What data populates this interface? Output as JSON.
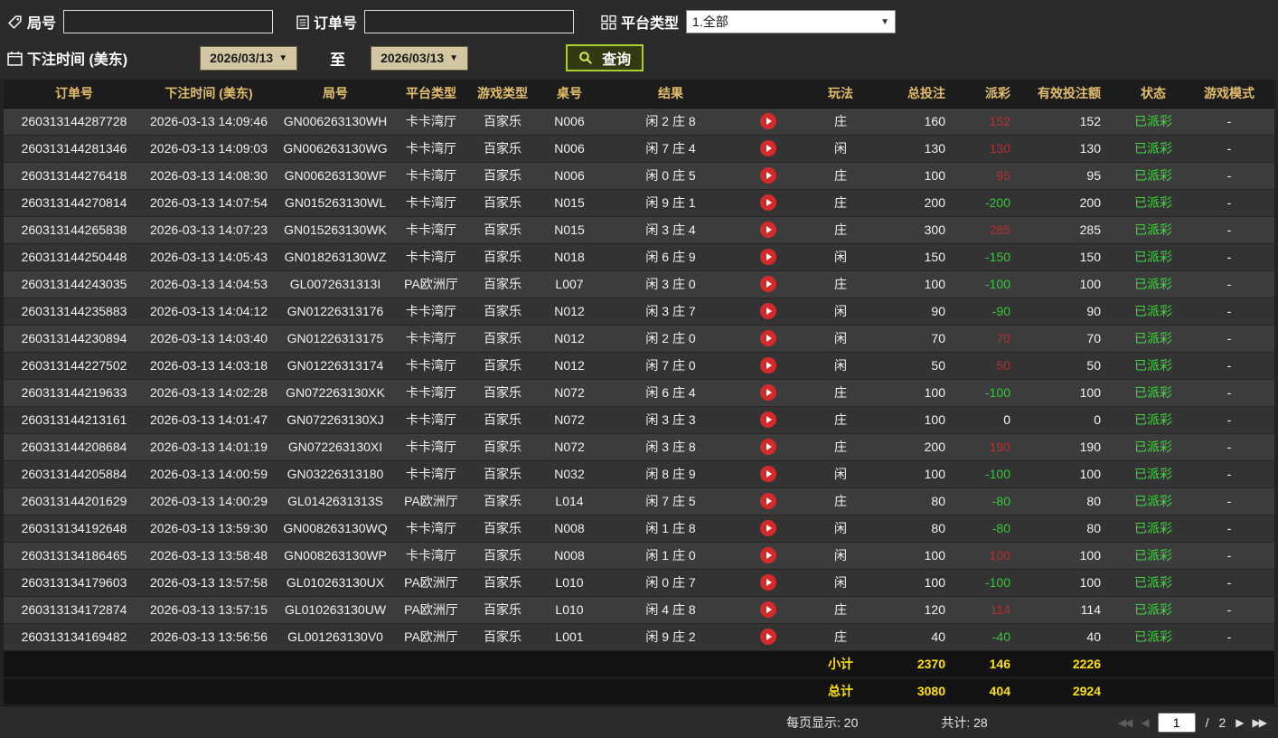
{
  "filters": {
    "round_label": "局号",
    "round_value": "",
    "order_label": "订单号",
    "order_value": "",
    "platform_label": "平台类型",
    "platform_value": "1.全部",
    "bet_time_label": "下注时间 (美东)",
    "date_from": "2026/03/13",
    "to_label": "至",
    "date_to": "2026/03/13",
    "search_label": "查询"
  },
  "icons": {
    "dropdown": "▼",
    "date_arrow": "▼",
    "first_page": "◀◀",
    "prev_page": "◀",
    "next_page": "▶",
    "last_page": "▶▶"
  },
  "table": {
    "headers": [
      "订单号",
      "下注时间 (美东)",
      "局号",
      "平台类型",
      "游戏类型",
      "桌号",
      "结果",
      "",
      "玩法",
      "总投注",
      "派彩",
      "有效投注额",
      "状态",
      "游戏模式"
    ],
    "rows": [
      {
        "order": "260313144287728",
        "time": "2026-03-13 14:09:46",
        "round": "GN006263130WH",
        "platform": "卡卡湾厅",
        "game": "百家乐",
        "table_no": "N006",
        "result": "闲 2 庄 8",
        "bet_side": "庄",
        "total_bet": "160",
        "payout": "152",
        "valid_bet": "152",
        "status": "已派彩",
        "mode": "-"
      },
      {
        "order": "260313144281346",
        "time": "2026-03-13 14:09:03",
        "round": "GN006263130WG",
        "platform": "卡卡湾厅",
        "game": "百家乐",
        "table_no": "N006",
        "result": "闲 7 庄 4",
        "bet_side": "闲",
        "total_bet": "130",
        "payout": "130",
        "valid_bet": "130",
        "status": "已派彩",
        "mode": "-"
      },
      {
        "order": "260313144276418",
        "time": "2026-03-13 14:08:30",
        "round": "GN006263130WF",
        "platform": "卡卡湾厅",
        "game": "百家乐",
        "table_no": "N006",
        "result": "闲 0 庄 5",
        "bet_side": "庄",
        "total_bet": "100",
        "payout": "95",
        "valid_bet": "95",
        "status": "已派彩",
        "mode": "-"
      },
      {
        "order": "260313144270814",
        "time": "2026-03-13 14:07:54",
        "round": "GN015263130WL",
        "platform": "卡卡湾厅",
        "game": "百家乐",
        "table_no": "N015",
        "result": "闲 9 庄 1",
        "bet_side": "庄",
        "total_bet": "200",
        "payout": "-200",
        "valid_bet": "200",
        "status": "已派彩",
        "mode": "-"
      },
      {
        "order": "260313144265838",
        "time": "2026-03-13 14:07:23",
        "round": "GN015263130WK",
        "platform": "卡卡湾厅",
        "game": "百家乐",
        "table_no": "N015",
        "result": "闲 3 庄 4",
        "bet_side": "庄",
        "total_bet": "300",
        "payout": "285",
        "valid_bet": "285",
        "status": "已派彩",
        "mode": "-"
      },
      {
        "order": "260313144250448",
        "time": "2026-03-13 14:05:43",
        "round": "GN018263130WZ",
        "platform": "卡卡湾厅",
        "game": "百家乐",
        "table_no": "N018",
        "result": "闲 6 庄 9",
        "bet_side": "闲",
        "total_bet": "150",
        "payout": "-150",
        "valid_bet": "150",
        "status": "已派彩",
        "mode": "-"
      },
      {
        "order": "260313144243035",
        "time": "2026-03-13 14:04:53",
        "round": "GL0072631313I",
        "platform": "PA欧洲厅",
        "game": "百家乐",
        "table_no": "L007",
        "result": "闲 3 庄 0",
        "bet_side": "庄",
        "total_bet": "100",
        "payout": "-100",
        "valid_bet": "100",
        "status": "已派彩",
        "mode": "-"
      },
      {
        "order": "260313144235883",
        "time": "2026-03-13 14:04:12",
        "round": "GN01226313176",
        "platform": "卡卡湾厅",
        "game": "百家乐",
        "table_no": "N012",
        "result": "闲 3 庄 7",
        "bet_side": "闲",
        "total_bet": "90",
        "payout": "-90",
        "valid_bet": "90",
        "status": "已派彩",
        "mode": "-"
      },
      {
        "order": "260313144230894",
        "time": "2026-03-13 14:03:40",
        "round": "GN01226313175",
        "platform": "卡卡湾厅",
        "game": "百家乐",
        "table_no": "N012",
        "result": "闲 2 庄 0",
        "bet_side": "闲",
        "total_bet": "70",
        "payout": "70",
        "valid_bet": "70",
        "status": "已派彩",
        "mode": "-"
      },
      {
        "order": "260313144227502",
        "time": "2026-03-13 14:03:18",
        "round": "GN01226313174",
        "platform": "卡卡湾厅",
        "game": "百家乐",
        "table_no": "N012",
        "result": "闲 7 庄 0",
        "bet_side": "闲",
        "total_bet": "50",
        "payout": "50",
        "valid_bet": "50",
        "status": "已派彩",
        "mode": "-"
      },
      {
        "order": "260313144219633",
        "time": "2026-03-13 14:02:28",
        "round": "GN072263130XK",
        "platform": "卡卡湾厅",
        "game": "百家乐",
        "table_no": "N072",
        "result": "闲 6 庄 4",
        "bet_side": "庄",
        "total_bet": "100",
        "payout": "-100",
        "valid_bet": "100",
        "status": "已派彩",
        "mode": "-"
      },
      {
        "order": "260313144213161",
        "time": "2026-03-13 14:01:47",
        "round": "GN072263130XJ",
        "platform": "卡卡湾厅",
        "game": "百家乐",
        "table_no": "N072",
        "result": "闲 3 庄 3",
        "bet_side": "庄",
        "total_bet": "100",
        "payout": "0",
        "valid_bet": "0",
        "status": "已派彩",
        "mode": "-"
      },
      {
        "order": "260313144208684",
        "time": "2026-03-13 14:01:19",
        "round": "GN072263130XI",
        "platform": "卡卡湾厅",
        "game": "百家乐",
        "table_no": "N072",
        "result": "闲 3 庄 8",
        "bet_side": "庄",
        "total_bet": "200",
        "payout": "190",
        "valid_bet": "190",
        "status": "已派彩",
        "mode": "-"
      },
      {
        "order": "260313144205884",
        "time": "2026-03-13 14:00:59",
        "round": "GN03226313180",
        "platform": "卡卡湾厅",
        "game": "百家乐",
        "table_no": "N032",
        "result": "闲 8 庄 9",
        "bet_side": "闲",
        "total_bet": "100",
        "payout": "-100",
        "valid_bet": "100",
        "status": "已派彩",
        "mode": "-"
      },
      {
        "order": "260313144201629",
        "time": "2026-03-13 14:00:29",
        "round": "GL0142631313S",
        "platform": "PA欧洲厅",
        "game": "百家乐",
        "table_no": "L014",
        "result": "闲 7 庄 5",
        "bet_side": "庄",
        "total_bet": "80",
        "payout": "-80",
        "valid_bet": "80",
        "status": "已派彩",
        "mode": "-"
      },
      {
        "order": "260313134192648",
        "time": "2026-03-13 13:59:30",
        "round": "GN008263130WQ",
        "platform": "卡卡湾厅",
        "game": "百家乐",
        "table_no": "N008",
        "result": "闲 1 庄 8",
        "bet_side": "闲",
        "total_bet": "80",
        "payout": "-80",
        "valid_bet": "80",
        "status": "已派彩",
        "mode": "-"
      },
      {
        "order": "260313134186465",
        "time": "2026-03-13 13:58:48",
        "round": "GN008263130WP",
        "platform": "卡卡湾厅",
        "game": "百家乐",
        "table_no": "N008",
        "result": "闲 1 庄 0",
        "bet_side": "闲",
        "total_bet": "100",
        "payout": "100",
        "valid_bet": "100",
        "status": "已派彩",
        "mode": "-"
      },
      {
        "order": "260313134179603",
        "time": "2026-03-13 13:57:58",
        "round": "GL010263130UX",
        "platform": "PA欧洲厅",
        "game": "百家乐",
        "table_no": "L010",
        "result": "闲 0 庄 7",
        "bet_side": "闲",
        "total_bet": "100",
        "payout": "-100",
        "valid_bet": "100",
        "status": "已派彩",
        "mode": "-"
      },
      {
        "order": "260313134172874",
        "time": "2026-03-13 13:57:15",
        "round": "GL010263130UW",
        "platform": "PA欧洲厅",
        "game": "百家乐",
        "table_no": "L010",
        "result": "闲 4 庄 8",
        "bet_side": "庄",
        "total_bet": "120",
        "payout": "114",
        "valid_bet": "114",
        "status": "已派彩",
        "mode": "-"
      },
      {
        "order": "260313134169482",
        "time": "2026-03-13 13:56:56",
        "round": "GL001263130V0",
        "platform": "PA欧洲厅",
        "game": "百家乐",
        "table_no": "L001",
        "result": "闲 9 庄 2",
        "bet_side": "庄",
        "total_bet": "40",
        "payout": "-40",
        "valid_bet": "40",
        "status": "已派彩",
        "mode": "-"
      }
    ],
    "subtotal": {
      "label": "小计",
      "total_bet": "2370",
      "payout": "146",
      "valid_bet": "2226"
    },
    "grand_total": {
      "label": "总计",
      "total_bet": "3080",
      "payout": "404",
      "valid_bet": "2924"
    }
  },
  "pagination": {
    "per_page_label": "每页显示: 20",
    "total_label": "共计: 28",
    "current_page": "1",
    "separator": "/",
    "total_pages": "2"
  }
}
